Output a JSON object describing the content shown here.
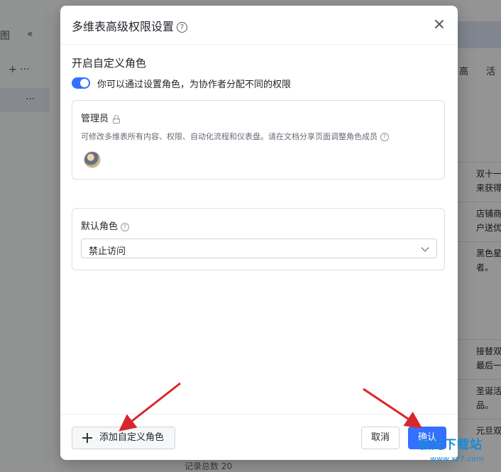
{
  "background": {
    "sidebar_items": [
      "图",
      "«",
      "+ ···",
      "···"
    ],
    "toolbar_fragment": "高",
    "column_header_fragment": "活",
    "cells": [
      "双十一",
      "来获得",
      "店铺商",
      "户送优",
      "黑色星",
      "者。",
      "接替双",
      "最后一",
      "圣诞活",
      "品。",
      "元旦双"
    ],
    "footer_text": "记录总数 20"
  },
  "dialog": {
    "title": "多维表高级权限设置",
    "help_symbol": "?",
    "section_title": "开启自定义角色",
    "toggle_label": "你可以通过设置角色，为协作者分配不同的权限",
    "toggle_on": true,
    "admin_card": {
      "title": "管理员",
      "description": "可修改多维表所有内容、权限、自动化流程和仪表盘。请在文档分享页面调整角色成员"
    },
    "default_role_card": {
      "title": "默认角色",
      "selected": "禁止访问"
    },
    "footer": {
      "add_role_label": "添加自定义角色",
      "cancel_label": "取消",
      "confirm_label": "确认"
    }
  },
  "watermark": {
    "text": "极光下载站",
    "url_text": "www.xz7.com"
  },
  "colors": {
    "accent": "#3370ff",
    "annotation_arrow": "#d9262b"
  },
  "icons": {
    "help": "help-circle-icon",
    "close": "close-icon",
    "lock": "lock-icon",
    "chevron": "chevron-down-icon",
    "plus": "plus-icon"
  }
}
